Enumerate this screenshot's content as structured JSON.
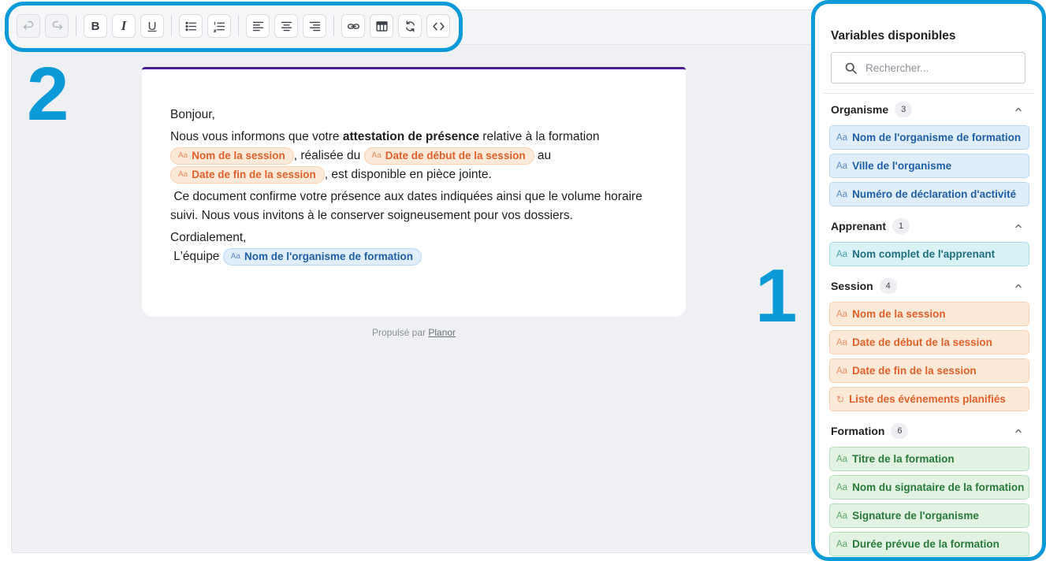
{
  "toolbar": {
    "bold": "B",
    "italic": "I",
    "underline": "U",
    "icons": [
      "undo-icon",
      "redo-icon",
      "bullet-list-icon",
      "numbered-list-icon",
      "align-left-icon",
      "align-center-icon",
      "align-right-icon",
      "link-icon",
      "table-icon",
      "loop-icon",
      "code-icon"
    ]
  },
  "annotations": {
    "toolbar_number": "2",
    "sidebar_number": "1"
  },
  "accent_colors": {
    "annotation": "#0b9ad8",
    "card_top_border": "#4b1d93"
  },
  "email": {
    "greeting": "Bonjour,",
    "line1_a": " Nous vous informons que votre ",
    "line1_bold": "attestation de présence",
    "line1_b": " relative à la formation",
    "chip_session_name": "Nom de la session",
    "text_realisee": ", réalisée du ",
    "chip_start_date": "Date de début de la session",
    "text_au": " au",
    "chip_end_date": "Date de fin de la session",
    "text_dispo": ", est disponible en pièce jointe.",
    "paragraph2": " Ce document confirme votre présence aux dates indiquées ainsi que le volume horaire suivi. Nous vous invitons à le conserver soigneusement pour vos dossiers.",
    "closing": "Cordialement,",
    "team_prefix": " L'équipe ",
    "chip_org_name": "Nom de l'organisme de formation",
    "chip_prefix": "Aa"
  },
  "footer": {
    "powered_by": "Propulsé par ",
    "brand": "Planor"
  },
  "sidebar": {
    "title": "Variables disponibles",
    "search_placeholder": "Rechercher...",
    "groups": [
      {
        "name": "Organisme",
        "count": "3",
        "items": [
          "Nom de l'organisme de formation",
          "Ville de l'organisme",
          "Numéro de déclaration d'activité"
        ]
      },
      {
        "name": "Apprenant",
        "count": "1",
        "items": [
          "Nom complet de l'apprenant"
        ]
      },
      {
        "name": "Session",
        "count": "4",
        "items": [
          "Nom de la session",
          "Date de début de la session",
          "Date de fin de la session",
          "Liste des événements planifiés"
        ]
      },
      {
        "name": "Formation",
        "count": "6",
        "items": [
          "Titre de la formation",
          "Nom du signataire de la formation",
          "Signature de l'organisme",
          "Durée prévue de la formation"
        ]
      }
    ],
    "item_prefix": "Aa",
    "loop_prefix": "↻"
  }
}
